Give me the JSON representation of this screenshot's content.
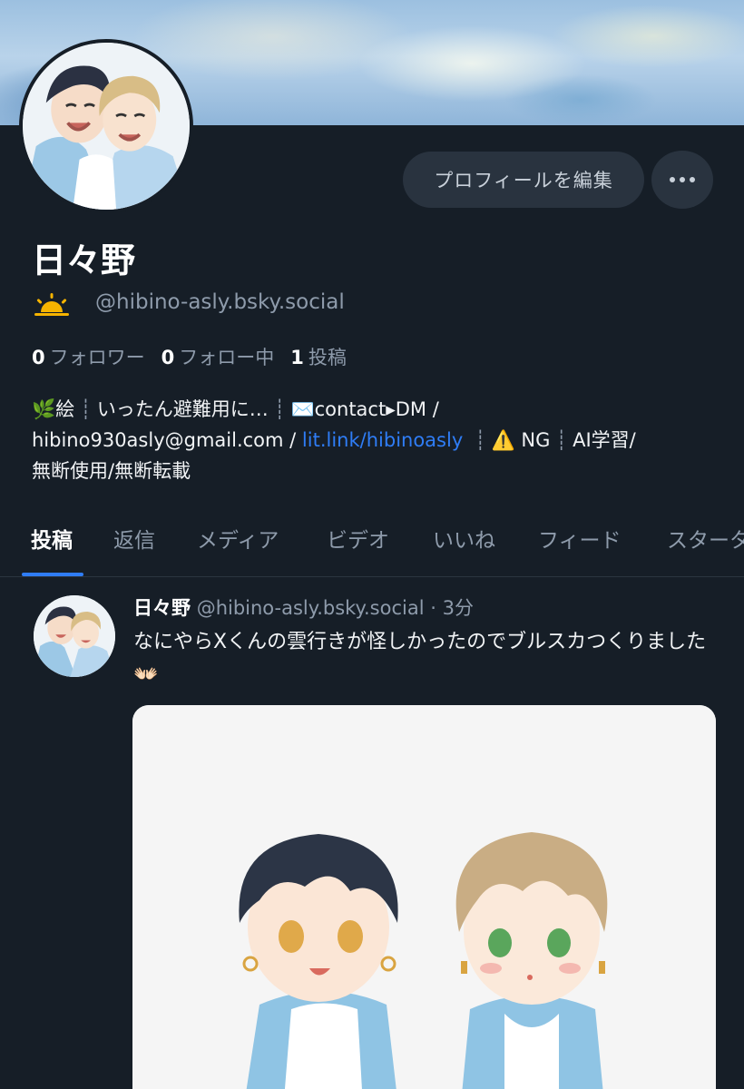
{
  "banner": {
    "icon": "painted-sky-banner"
  },
  "profile": {
    "display_name": "日々野",
    "status_emoji": "sunrise-icon",
    "handle": "@hibino-asly.bsky.social",
    "edit_button": "プロフィールを編集",
    "more_button": "more-options-icon",
    "stats": {
      "followers": {
        "count": "0",
        "label": "フォロワー"
      },
      "following": {
        "count": "0",
        "label": "フォロー中"
      },
      "posts": {
        "count": "1",
        "label": "投稿"
      }
    },
    "bio": {
      "part1": "🌿絵",
      "part2": "いったん避難用に…",
      "part3": "✉️contact▸DM /",
      "part4": "hibino930asly@gmail.com /",
      "link": "lit.link/hibinoasly",
      "part5": "⚠️ NG",
      "part6": "AI学習/",
      "part7": "無断使用/無断転載"
    }
  },
  "tabs": [
    {
      "label": "投稿",
      "active": true
    },
    {
      "label": "返信"
    },
    {
      "label": "メディア"
    },
    {
      "label": "ビデオ"
    },
    {
      "label": "いいね"
    },
    {
      "label": "フィード"
    },
    {
      "label": "スターター"
    }
  ],
  "post": {
    "author_name": "日々野",
    "author_handle": "@hibino-asly.bsky.social",
    "separator": " · ",
    "time": "3分",
    "text": "なにやらXくんの雲行きが怪しかったのでブルスカつくりました👐🏻",
    "image": "illustration-two-chibi-characters"
  },
  "colors": {
    "background": "#161e27",
    "accent": "#2f7df6",
    "muted": "#8e9bab",
    "button_bg": "#29333f"
  }
}
